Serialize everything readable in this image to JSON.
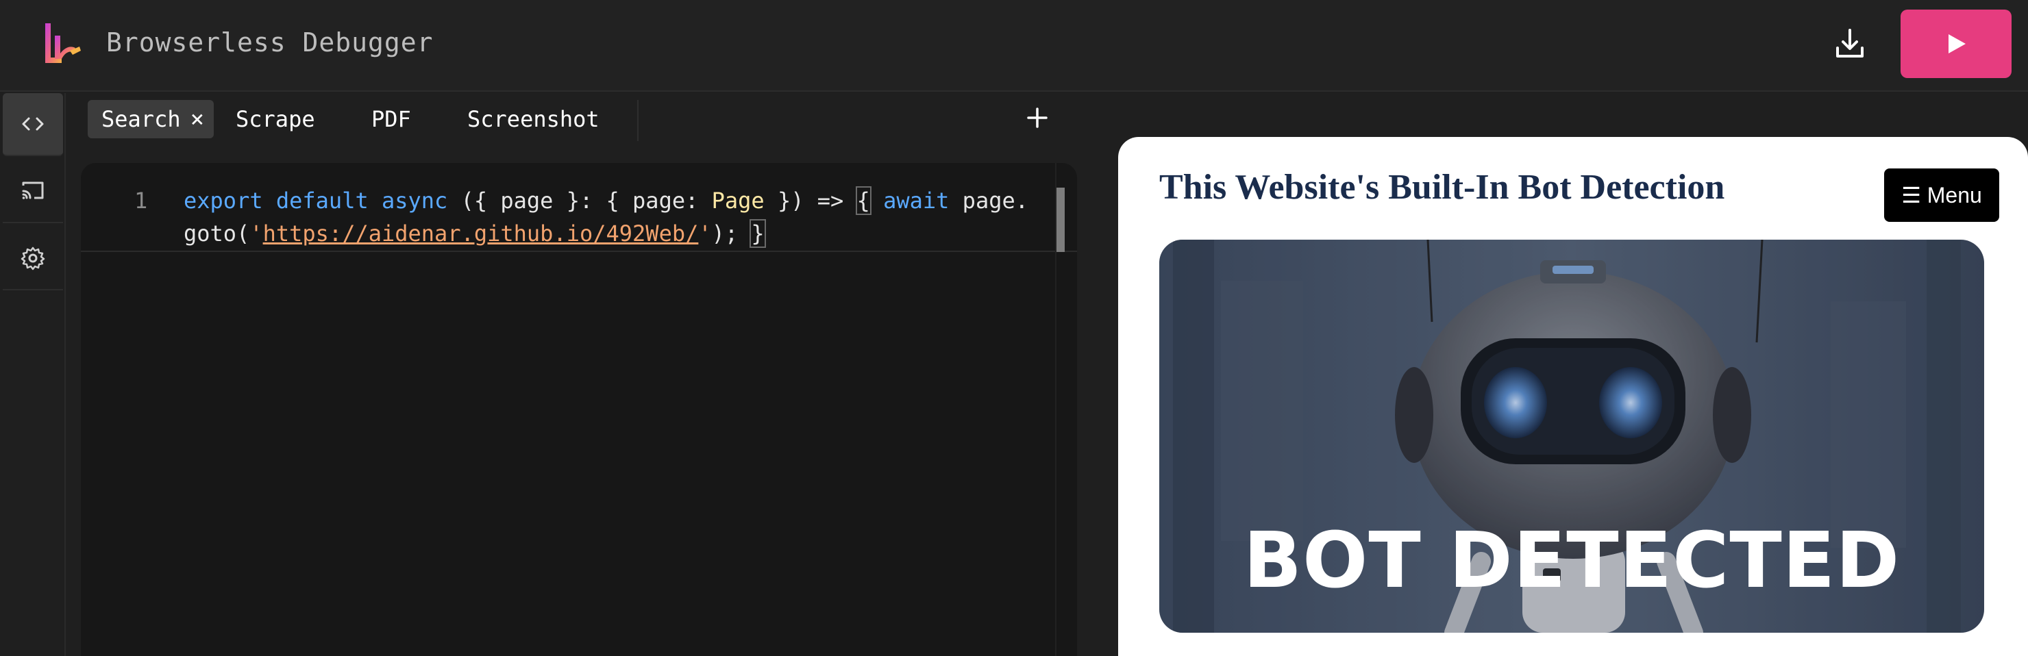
{
  "app": {
    "title": "Browserless Debugger"
  },
  "colors": {
    "accent": "#e63c7f",
    "background": "#1f1f1f",
    "editor": "#171717",
    "keyword": "#5aa9ff",
    "string": "#f2a36e",
    "type": "#ffe9a6"
  },
  "header": {
    "logo_icon": "browserless-logo-icon",
    "download_icon": "download-icon",
    "run_icon": "play-icon"
  },
  "sidebar": {
    "items": [
      {
        "name": "code",
        "icon": "code-icon",
        "active": true
      },
      {
        "name": "cast",
        "icon": "cast-icon",
        "active": false
      },
      {
        "name": "settings",
        "icon": "gear-icon",
        "active": false
      }
    ]
  },
  "tabs": [
    {
      "label": "Search",
      "active": true,
      "closable": true,
      "close_glyph": "×"
    },
    {
      "label": "Scrape",
      "active": false
    },
    {
      "label": "PDF",
      "active": false
    },
    {
      "label": "Screenshot",
      "active": false
    }
  ],
  "add_tab": {
    "label": "+"
  },
  "editor": {
    "line_number": "1",
    "line1": {
      "kw_export": "export",
      "kw_default": "default",
      "kw_async": "async",
      "t1": "({ page }: { page: ",
      "type": "Page",
      "t2": " }) => ",
      "brace_open": "{",
      "kw_await": "await",
      "t3": " page."
    },
    "line2": {
      "t1": "goto(",
      "q1": "'",
      "url": "https://aidenar.github.io/492Web/",
      "q2": "'",
      "t2": "); ",
      "brace_close": "}"
    }
  },
  "preview": {
    "site_title": "This Website's Built-In Bot Detection",
    "menu_label": "☰ Menu",
    "hero_caption": "BOT DETECTED"
  }
}
